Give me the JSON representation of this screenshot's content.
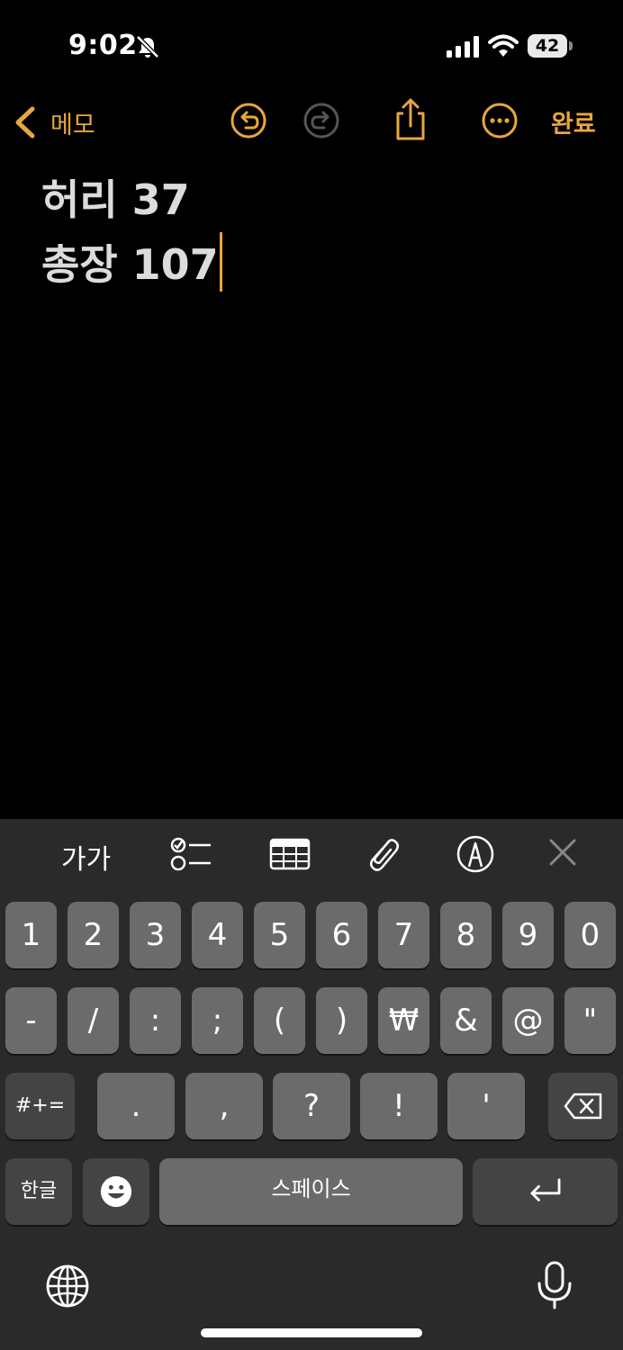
{
  "status": {
    "time": "9:02",
    "battery": "42"
  },
  "nav": {
    "back_label": "메모",
    "done_label": "완료"
  },
  "note": {
    "lines": [
      "허리 37",
      "총장 107"
    ]
  },
  "format_bar": {
    "text_style_label": "가가"
  },
  "keyboard": {
    "row1": [
      "1",
      "2",
      "3",
      "4",
      "5",
      "6",
      "7",
      "8",
      "9",
      "0"
    ],
    "row2": [
      "-",
      "/",
      ":",
      ";",
      "(",
      ")",
      "₩",
      "&",
      "@",
      "\""
    ],
    "row3": {
      "symbols_key": "#+=",
      "keys": [
        ".",
        ",",
        "?",
        "!",
        "'"
      ]
    },
    "row4": {
      "lang_key": "한글",
      "space_label": "스페이스"
    }
  },
  "colors": {
    "accent": "#e7a73c",
    "background": "#000000",
    "key": "#6b6b6b",
    "key_dark": "#444444"
  }
}
